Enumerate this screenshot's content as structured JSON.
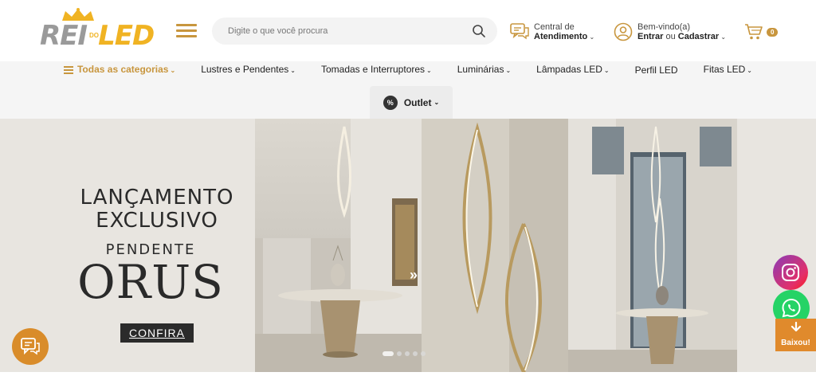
{
  "header": {
    "logo": {
      "part1": "REI",
      "part_do": "DO",
      "part2": "LED"
    },
    "menu_icon": "hamburger-icon",
    "search": {
      "placeholder": "Digite o que você procura",
      "icon": "search-icon"
    },
    "atendimento": {
      "line1": "Central de",
      "line2": "Atendimento",
      "icon": "chat-icon"
    },
    "conta": {
      "line1": "Bem-vindo(a)",
      "entrar": "Entrar",
      "ou": "ou",
      "cadastrar": "Cadastrar",
      "icon": "user-icon"
    },
    "cart": {
      "count": "0",
      "icon": "cart-icon"
    }
  },
  "nav": {
    "items": [
      {
        "label": "Todas as categorias",
        "chevron": "⌄"
      },
      {
        "label": "Lustres e Pendentes",
        "chevron": "⌄"
      },
      {
        "label": "Tomadas e Interruptores",
        "chevron": "⌄"
      },
      {
        "label": "Luminárias",
        "chevron": "⌄"
      },
      {
        "label": "Lâmpadas LED",
        "chevron": "⌄"
      },
      {
        "label": "Perfil LED",
        "chevron": ""
      },
      {
        "label": "Fitas LED",
        "chevron": "⌄"
      }
    ],
    "outlet": {
      "label": "Outlet",
      "chevron": "⌄",
      "icon_text": "%"
    }
  },
  "hero": {
    "title_line1": "LANÇAMENTO",
    "title_line2": "EXCLUSIVO",
    "subtitle": "PENDENTE",
    "product_name": "ORUS",
    "cta": "CONFIRA",
    "next_arrow": "»",
    "slides": 5,
    "active_slide": 1
  },
  "floating": {
    "chat_icon": "chat-bubble-icon",
    "instagram_icon": "instagram-icon",
    "whatsapp_icon": "whatsapp-icon",
    "baixou": "Baixou!"
  },
  "colors": {
    "brand_gold": "#c8963e",
    "orange": "#e08a2c",
    "dark": "#2b2b2b"
  }
}
